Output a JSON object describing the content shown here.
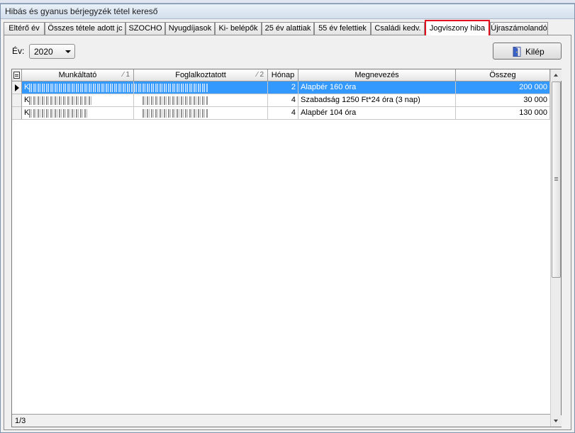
{
  "window": {
    "title": "Hibás és gyanus bérjegyzék tétel kereső"
  },
  "tabs": [
    {
      "label": "Eltérő év"
    },
    {
      "label": "Összes tétele adott jc"
    },
    {
      "label": "SZOCHO"
    },
    {
      "label": "Nyugdíjasok"
    },
    {
      "label": "Ki- belépők"
    },
    {
      "label": "25 év alattiak"
    },
    {
      "label": "55 év felettiek"
    },
    {
      "label": "Családi kedv."
    },
    {
      "label": "Jogviszony hiba",
      "active": true
    },
    {
      "label": "Újraszámolandó"
    }
  ],
  "filter": {
    "year_label": "Év:",
    "year_value": "2020"
  },
  "toolbar": {
    "exit_label": "Kilép",
    "exit_icon": "door-exit-icon"
  },
  "grid": {
    "columns": [
      {
        "label": "Munkáltató",
        "sort": "1"
      },
      {
        "label": "Foglalkoztatott",
        "sort": "2"
      },
      {
        "label": "Hónap"
      },
      {
        "label": "Megnevezés"
      },
      {
        "label": "Összeg"
      }
    ],
    "rows": [
      {
        "employer": "K",
        "employee": "",
        "month": "2",
        "name": "Alapbér 160 óra",
        "amount": "200 000",
        "selected": true
      },
      {
        "employer": "K",
        "employee": "",
        "month": "4",
        "name": "Szabadság 1250 Ft*24 óra (3 nap)",
        "amount": "30 000"
      },
      {
        "employer": "K",
        "employee": "",
        "month": "4",
        "name": "Alapbér 104 óra",
        "amount": "130 000"
      }
    ],
    "record_position": "1/3"
  },
  "colors": {
    "active_tab_border": "#e0101e",
    "selection": "#3399ff"
  }
}
